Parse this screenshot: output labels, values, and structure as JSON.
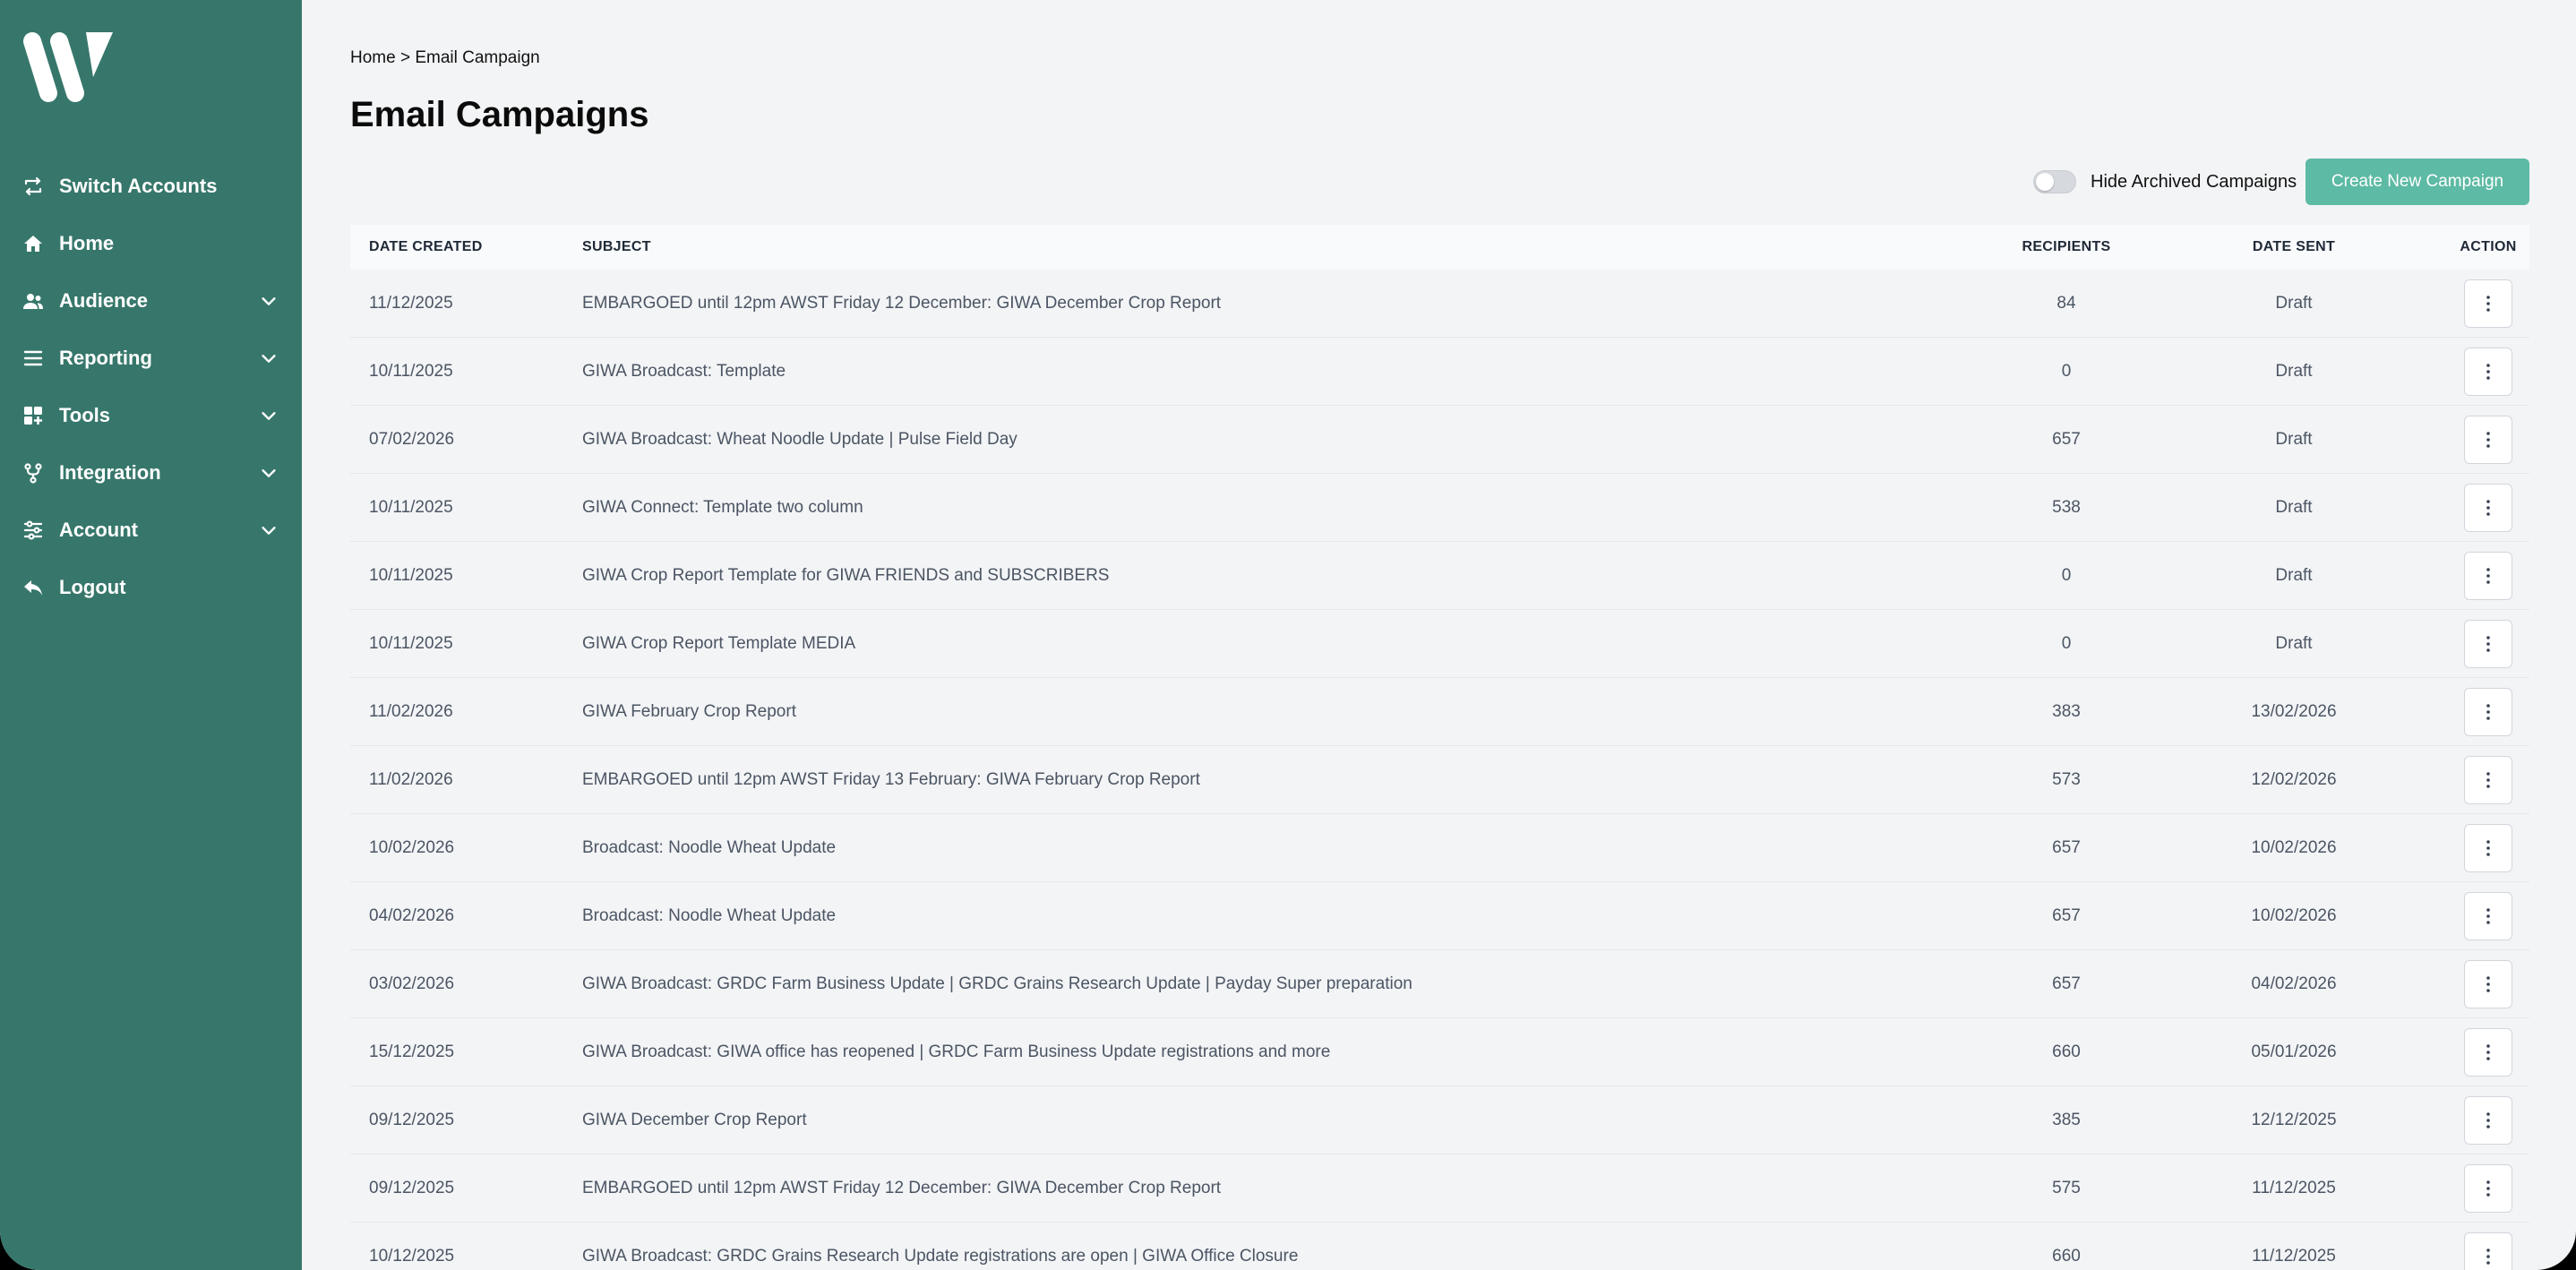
{
  "sidebar": {
    "logo_icon": "w-logo-icon",
    "items": [
      {
        "label": "Switch Accounts",
        "icon": "switch-accounts-icon",
        "has_chevron": false
      },
      {
        "label": "Home",
        "icon": "home-icon",
        "has_chevron": false
      },
      {
        "label": "Audience",
        "icon": "audience-icon",
        "has_chevron": true
      },
      {
        "label": "Reporting",
        "icon": "reporting-icon",
        "has_chevron": true
      },
      {
        "label": "Tools",
        "icon": "tools-icon",
        "has_chevron": true
      },
      {
        "label": "Integration",
        "icon": "integration-icon",
        "has_chevron": true
      },
      {
        "label": "Account",
        "icon": "account-icon",
        "has_chevron": true
      },
      {
        "label": "Logout",
        "icon": "logout-icon",
        "has_chevron": false
      }
    ],
    "bg_color": "#37776b"
  },
  "breadcrumb": "Home > Email Campaign",
  "page_title": "Email Campaigns",
  "toolbar": {
    "hide_archived_label": "Hide Archived Campaigns",
    "hide_archived_on": false,
    "create_button_label": "Create New Campaign",
    "accent_color": "#5dbaa4"
  },
  "table": {
    "headers": {
      "date_created": "DATE CREATED",
      "subject": "SUBJECT",
      "recipients": "RECIPIENTS",
      "date_sent": "DATE SENT",
      "action": "ACTION"
    },
    "rows": [
      {
        "date_created": "11/12/2025",
        "subject": "EMBARGOED until 12pm AWST Friday 12 December: GIWA December Crop Report",
        "recipients": "84",
        "date_sent": "Draft"
      },
      {
        "date_created": "10/11/2025",
        "subject": "GIWA Broadcast: Template",
        "recipients": "0",
        "date_sent": "Draft"
      },
      {
        "date_created": "07/02/2026",
        "subject": "GIWA Broadcast: Wheat Noodle Update | Pulse Field Day",
        "recipients": "657",
        "date_sent": "Draft"
      },
      {
        "date_created": "10/11/2025",
        "subject": "GIWA Connect: Template two column",
        "recipients": "538",
        "date_sent": "Draft"
      },
      {
        "date_created": "10/11/2025",
        "subject": "GIWA Crop Report Template for GIWA FRIENDS and SUBSCRIBERS",
        "recipients": "0",
        "date_sent": "Draft"
      },
      {
        "date_created": "10/11/2025",
        "subject": "GIWA Crop Report Template MEDIA",
        "recipients": "0",
        "date_sent": "Draft"
      },
      {
        "date_created": "11/02/2026",
        "subject": "GIWA February Crop Report",
        "recipients": "383",
        "date_sent": "13/02/2026"
      },
      {
        "date_created": "11/02/2026",
        "subject": "EMBARGOED until 12pm AWST Friday 13 February: GIWA February Crop Report",
        "recipients": "573",
        "date_sent": "12/02/2026"
      },
      {
        "date_created": "10/02/2026",
        "subject": "Broadcast: Noodle Wheat Update",
        "recipients": "657",
        "date_sent": "10/02/2026"
      },
      {
        "date_created": "04/02/2026",
        "subject": "Broadcast: Noodle Wheat Update",
        "recipients": "657",
        "date_sent": "10/02/2026"
      },
      {
        "date_created": "03/02/2026",
        "subject": "GIWA Broadcast: GRDC Farm Business Update | GRDC Grains Research Update | Payday Super preparation",
        "recipients": "657",
        "date_sent": "04/02/2026"
      },
      {
        "date_created": "15/12/2025",
        "subject": "GIWA Broadcast: GIWA office has reopened | GRDC Farm Business Update registrations and more",
        "recipients": "660",
        "date_sent": "05/01/2026"
      },
      {
        "date_created": "09/12/2025",
        "subject": "GIWA December Crop Report",
        "recipients": "385",
        "date_sent": "12/12/2025"
      },
      {
        "date_created": "09/12/2025",
        "subject": "EMBARGOED until 12pm AWST Friday 12 December: GIWA December Crop Report",
        "recipients": "575",
        "date_sent": "11/12/2025"
      },
      {
        "date_created": "10/12/2025",
        "subject": "GIWA Broadcast: GRDC Grains Research Update registrations are open | GIWA Office Closure",
        "recipients": "660",
        "date_sent": "11/12/2025"
      }
    ],
    "action_icon": "more-vertical-icon"
  }
}
